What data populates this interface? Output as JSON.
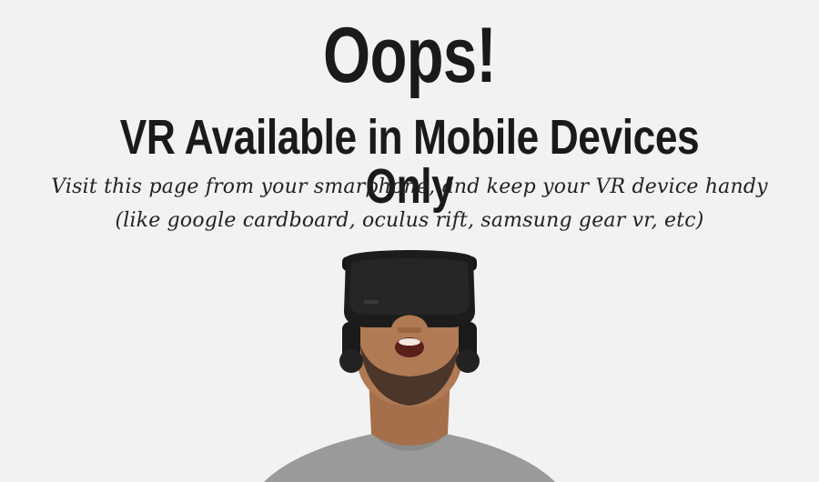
{
  "heading": {
    "title": "Oops!",
    "subtitle": "VR Available in Mobile Devices Only"
  },
  "message": {
    "line1": "Visit this page from your smarphone, and keep your VR device handy",
    "line2": "(like google cardboard, oculus rift, samsung gear vr, etc)"
  },
  "illustration": {
    "icon": "person-wearing-vr-headset",
    "colors": {
      "background": "#f2f2f2",
      "text": "#1a1a1a",
      "headset": "#1c1c1c",
      "skin": "#b07a55",
      "shirt": "#9a9a9a",
      "beard": "#3a2a22"
    }
  }
}
